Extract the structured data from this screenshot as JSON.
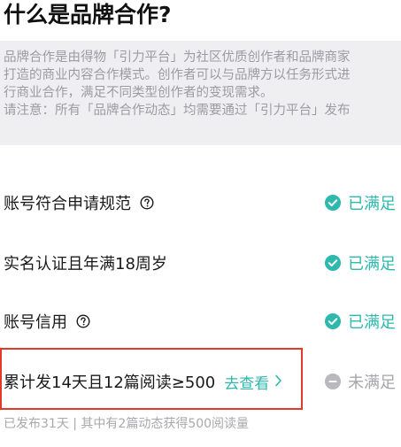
{
  "page": {
    "title": "什么是品牌合作?"
  },
  "intro": {
    "lines": [
      "品牌合作是由得物「引力平台」为社区优质创作者和品牌商家",
      "打造的商业内容合作模式。创作者可以与品牌方以任务形式进",
      "行商业合作，满足不同类型创作者的变现需求。",
      "请注意：所有「品牌合作动态」均需要通过「引力平台」发布"
    ]
  },
  "requirements": [
    {
      "label": "账号符合申请规范",
      "has_help": true,
      "status": "已满足",
      "met": true
    },
    {
      "label": "实名认证且年满18周岁",
      "has_help": false,
      "status": "已满足",
      "met": true
    },
    {
      "label": "账号信用",
      "has_help": true,
      "status": "已满足",
      "met": true
    },
    {
      "label": "累计发14天且12篇阅读≥500",
      "has_help": false,
      "status": "未满足",
      "met": false,
      "link": "去查看"
    }
  ],
  "footnote": "已发布31天 | 其中有2篇动态获得500阅读量",
  "colors": {
    "accent": "#2fb8ad",
    "unmet": "#a5a5ab",
    "highlight_border": "#e23a2a",
    "intro_bg": "#efeff2"
  },
  "icons": {
    "met": "check-circle-icon",
    "unmet": "minus-circle-icon",
    "help": "help-circle-icon",
    "link": "chevron-right-icon"
  }
}
